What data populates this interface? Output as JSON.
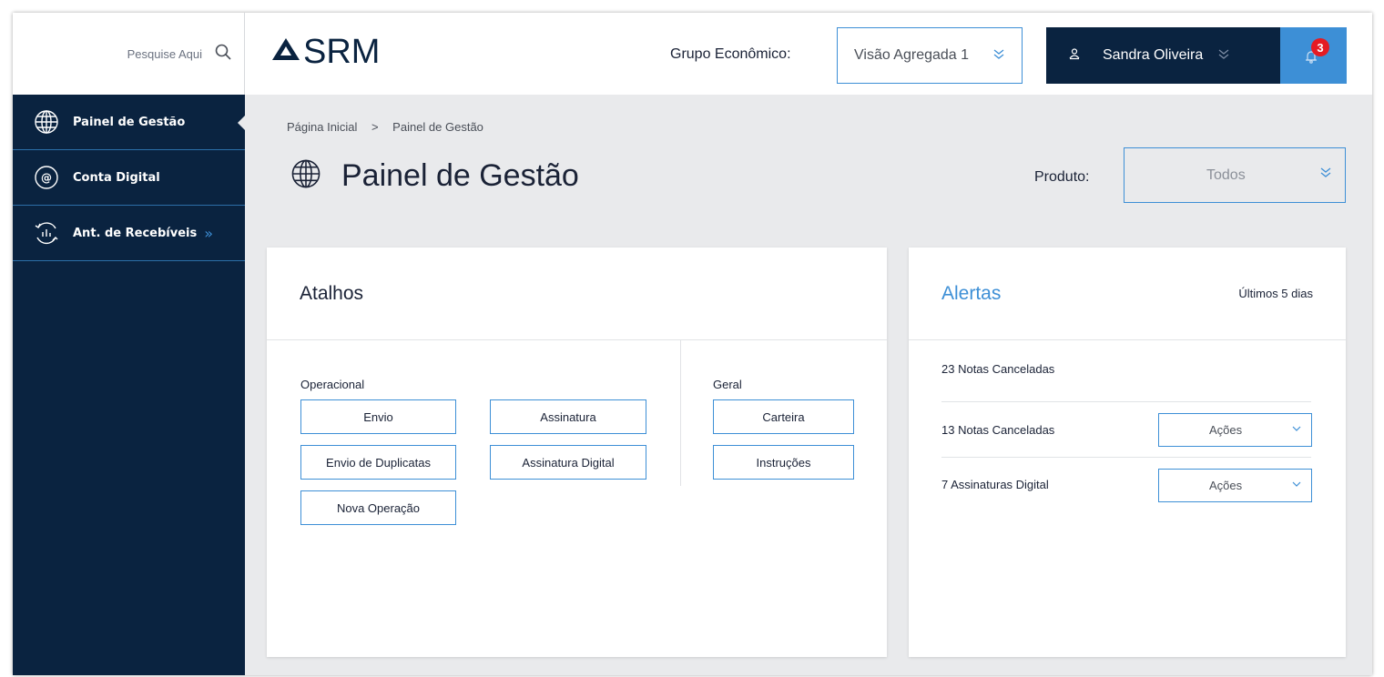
{
  "sidebar": {
    "search_placeholder": "Pesquise Aqui",
    "items": [
      {
        "label": "Painel de Gestão",
        "icon": "globe-icon",
        "active": true
      },
      {
        "label": "Conta Digital",
        "icon": "at-sign-icon",
        "active": false
      },
      {
        "label": "Ant. de Recebíveis",
        "icon": "receivables-chart-icon",
        "active": false,
        "chevron": "»"
      }
    ]
  },
  "header": {
    "logo_text": "SRM",
    "grupo_label": "Grupo Econômico:",
    "grupo_value": "Visão Agregada 1",
    "user_name": "Sandra Oliveira",
    "notification_count": "3"
  },
  "breadcrumb": {
    "home": "Página Inicial",
    "separator": ">",
    "current": "Painel de Gestão"
  },
  "page": {
    "title": "Painel de Gestão",
    "produto_label": "Produto:",
    "produto_value": "Todos"
  },
  "atalhos": {
    "title": "Atalhos",
    "operacional_label": "Operacional",
    "operacional_buttons": [
      "Envio",
      "Assinatura",
      "Envio de Duplicatas",
      "Assinatura Digital",
      "Nova Operação"
    ],
    "geral_label": "Geral",
    "geral_buttons": [
      "Carteira",
      "Instruções"
    ]
  },
  "alertas": {
    "title": "Alertas",
    "period": "Últimos 5 dias",
    "items": [
      {
        "text": "23 Notas Canceladas",
        "action": null
      },
      {
        "text": "13 Notas Canceladas",
        "action": "Ações"
      },
      {
        "text": "7 Assinaturas Digital",
        "action": "Ações"
      }
    ]
  },
  "colors": {
    "navy": "#0a2340",
    "accent_blue": "#3d8fd6",
    "badge_red": "#e41b23",
    "background": "#e9eaec"
  }
}
